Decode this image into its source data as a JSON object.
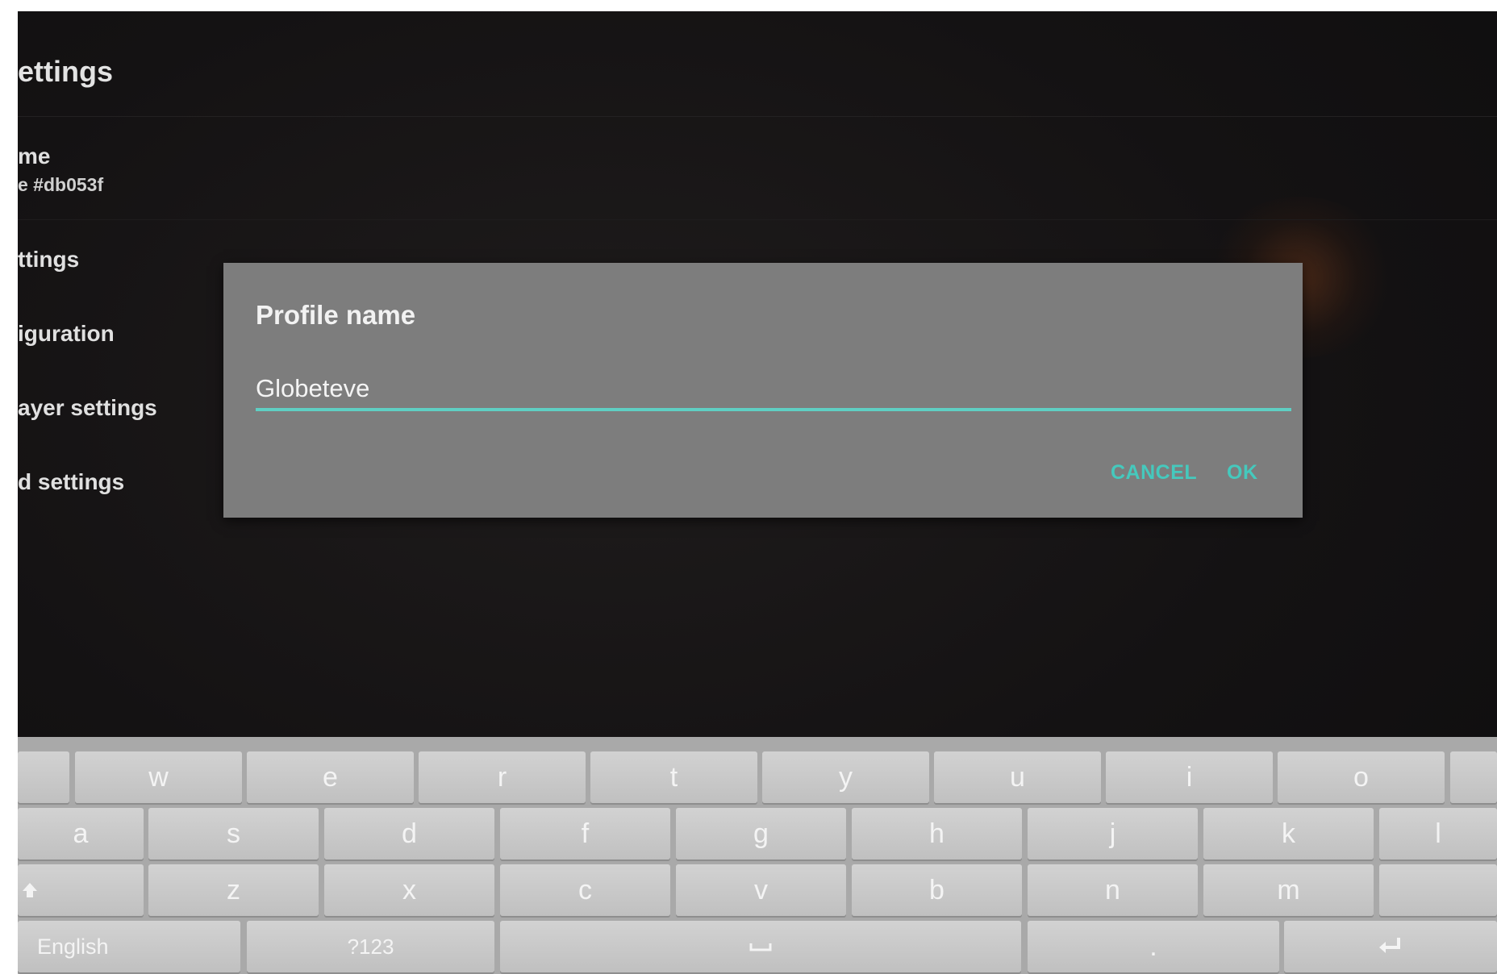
{
  "settings_page": {
    "title": "ettings",
    "items": [
      {
        "label": "me",
        "sub": "e #db053f"
      },
      {
        "label": "ttings"
      },
      {
        "label": "iguration"
      },
      {
        "label": "ayer settings"
      },
      {
        "label": "d settings"
      }
    ]
  },
  "dialog": {
    "title": "Profile name",
    "input_value": "Globeteve",
    "cancel_label": "CANCEL",
    "ok_label": "OK",
    "accent_color": "#45c9bd"
  },
  "keyboard": {
    "row1": [
      "w",
      "e",
      "r",
      "t",
      "y",
      "u",
      "i",
      "o"
    ],
    "row2": [
      "a",
      "s",
      "d",
      "f",
      "g",
      "h",
      "j",
      "k",
      "l"
    ],
    "row3": [
      "z",
      "x",
      "c",
      "v",
      "b",
      "n",
      "m"
    ],
    "language_label": "English",
    "symbols_label": "?123",
    "period_label": ".",
    "shift_icon": "shift-icon",
    "enter_icon": "enter-icon",
    "space_icon": "space-bar-icon"
  }
}
